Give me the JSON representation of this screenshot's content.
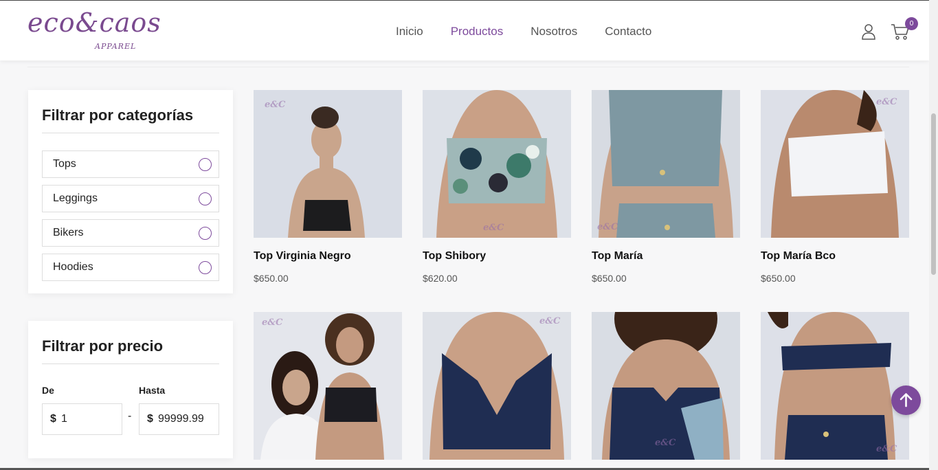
{
  "brand": {
    "logo_text": "eco&caos",
    "logo_sub": "APPAREL",
    "accent_color": "#7d4a9c"
  },
  "nav": {
    "items": [
      {
        "label": "Inicio",
        "active": false
      },
      {
        "label": "Productos",
        "active": true
      },
      {
        "label": "Nosotros",
        "active": false
      },
      {
        "label": "Contacto",
        "active": false
      }
    ]
  },
  "header_icons": {
    "user_icon": "user-icon",
    "cart_icon": "cart-icon",
    "cart_count": "0"
  },
  "filters": {
    "categories": {
      "title": "Filtrar por categorías",
      "items": [
        {
          "label": "Tops",
          "selected": false
        },
        {
          "label": "Leggings",
          "selected": false
        },
        {
          "label": "Bikers",
          "selected": false
        },
        {
          "label": "Hoodies",
          "selected": false
        }
      ]
    },
    "price": {
      "title": "Filtrar por precio",
      "from_label": "De",
      "to_label": "Hasta",
      "currency": "$",
      "from_value": "1",
      "to_value": "99999.99",
      "separator": "-"
    }
  },
  "products": [
    {
      "name": "Top Virginia Negro",
      "price": "$650.00",
      "watermark": "e&C"
    },
    {
      "name": "Top Shibory",
      "price": "$620.00",
      "watermark": "e&C"
    },
    {
      "name": "Top María",
      "price": "$650.00",
      "watermark": "e&C"
    },
    {
      "name": "Top María Bco",
      "price": "$650.00",
      "watermark": "e&C"
    },
    {
      "name": "",
      "price": "",
      "watermark": "e&C"
    },
    {
      "name": "",
      "price": "",
      "watermark": "e&C"
    },
    {
      "name": "",
      "price": "",
      "watermark": "e&C"
    },
    {
      "name": "",
      "price": "",
      "watermark": "e&C"
    }
  ]
}
